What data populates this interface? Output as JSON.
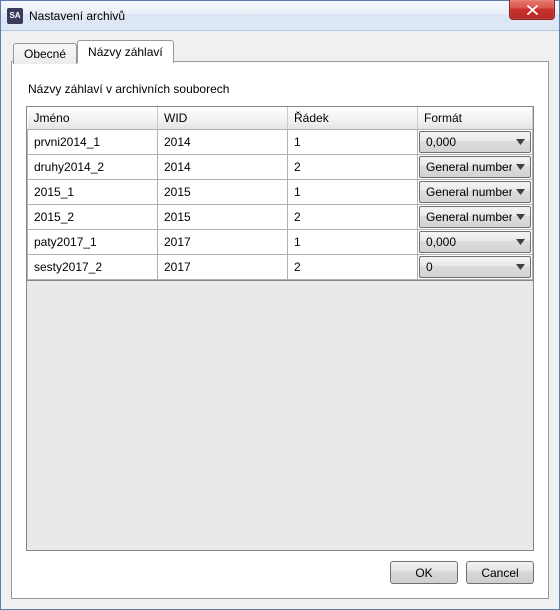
{
  "window": {
    "title": "Nastavení archivů",
    "app_icon_text": "SA"
  },
  "tabs": {
    "general": "Obecné",
    "headers": "Názvy záhlaví"
  },
  "panel": {
    "label": "Názvy záhlaví v archivních souborech"
  },
  "grid": {
    "columns": {
      "name": "Jméno",
      "wid": "WID",
      "row": "Řádek",
      "format": "Formát"
    },
    "rows": [
      {
        "name": "prvni2014_1",
        "wid": "2014",
        "row": "1",
        "format": "0,000"
      },
      {
        "name": "druhy2014_2",
        "wid": "2014",
        "row": "2",
        "format": "General number"
      },
      {
        "name": "2015_1",
        "wid": "2015",
        "row": "1",
        "format": "General number"
      },
      {
        "name": "2015_2",
        "wid": "2015",
        "row": "2",
        "format": "General number"
      },
      {
        "name": "paty2017_1",
        "wid": "2017",
        "row": "1",
        "format": "0,000"
      },
      {
        "name": "sesty2017_2",
        "wid": "2017",
        "row": "2",
        "format": "0"
      }
    ]
  },
  "buttons": {
    "ok": "OK",
    "cancel": "Cancel"
  }
}
